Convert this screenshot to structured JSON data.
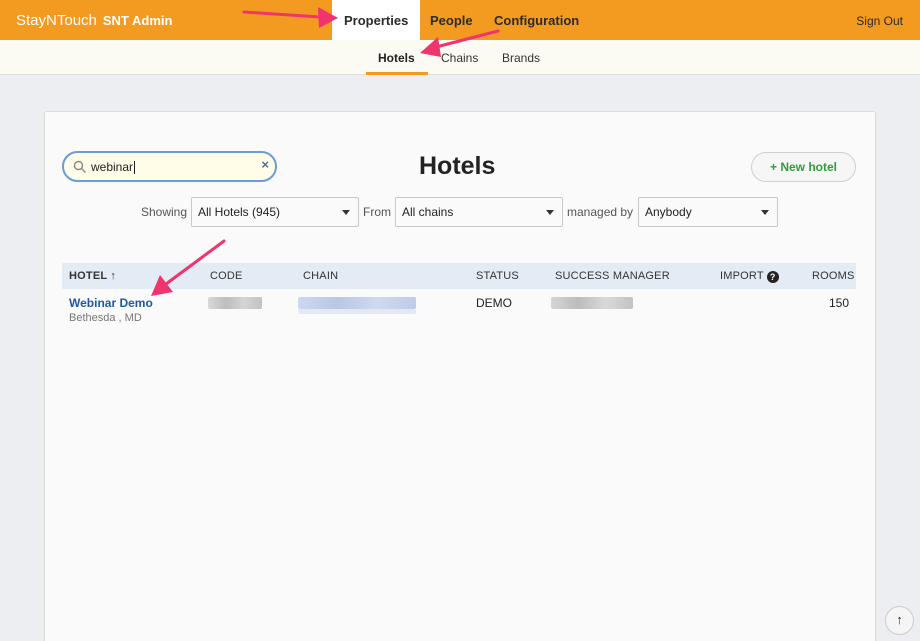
{
  "topbar": {
    "brand": "StayNTouch",
    "brand_sub": "SNT Admin",
    "tabs": [
      {
        "label": "Properties",
        "active": true
      },
      {
        "label": "People",
        "active": false
      },
      {
        "label": "Configuration",
        "active": false
      }
    ],
    "sign_out": "Sign Out"
  },
  "subnav": {
    "items": [
      {
        "label": "Hotels",
        "active": true
      },
      {
        "label": "Chains",
        "active": false
      },
      {
        "label": "Brands",
        "active": false
      }
    ]
  },
  "search": {
    "value": "webinar",
    "icon": "search-icon",
    "clear_icon": "close-icon"
  },
  "page_title": "Hotels",
  "new_hotel_button": "+ New hotel",
  "filters": {
    "showing_label": "Showing",
    "showing_value": "All Hotels (945)",
    "from_label": "From",
    "from_value": "All chains",
    "managed_label": "managed by",
    "managed_value": "Anybody"
  },
  "table": {
    "headers": {
      "hotel": "HOTEL ↑",
      "code": "CODE",
      "chain": "CHAIN",
      "status": "STATUS",
      "success_manager": "SUCCESS MANAGER",
      "import": "IMPORT",
      "rooms": "ROOMS"
    },
    "rows": [
      {
        "name": "Webinar Demo",
        "location": "Bethesda , MD",
        "status": "DEMO",
        "rooms": "150"
      }
    ]
  },
  "scroll_top": "↑",
  "colors": {
    "accent": "#f39a21",
    "link": "#1f5aa6",
    "new_button": "#2f9e3a",
    "annotation_arrow": "#f0346e"
  }
}
